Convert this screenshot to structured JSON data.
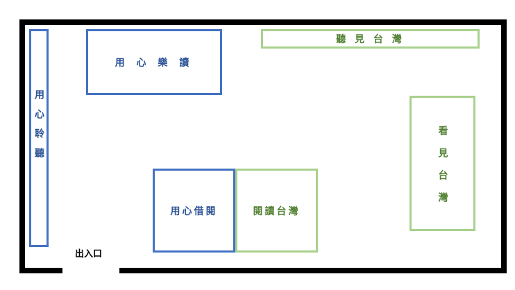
{
  "zones": {
    "left_vertical": {
      "label": "用心聆聽"
    },
    "top_left": {
      "label": "用 心 樂 讀"
    },
    "top_right": {
      "label": "聽 見 台 灣"
    },
    "right_vertical": {
      "label": "看見台灣"
    },
    "center_blue": {
      "label": "用心借閱"
    },
    "center_green": {
      "label": "閱讀台灣"
    }
  },
  "entrance": {
    "label": "出入口"
  },
  "colors": {
    "blue_border": "#4472c4",
    "blue_text": "#2f5597",
    "green_border": "#a9d18e",
    "green_text": "#548235",
    "wall": "#000000"
  }
}
